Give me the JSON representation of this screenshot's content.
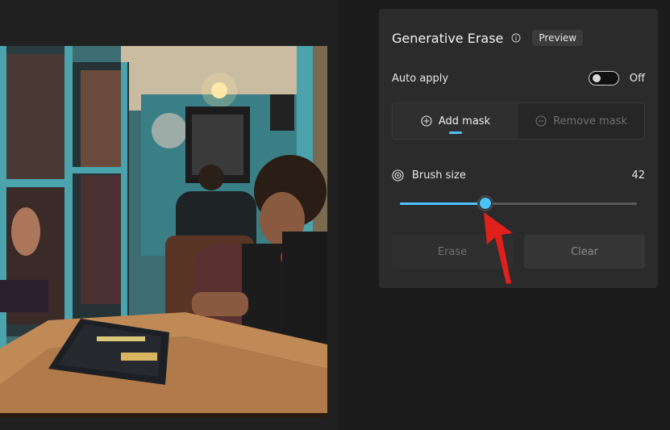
{
  "panel": {
    "title": "Generative Erase",
    "preview_badge": "Preview",
    "auto_apply": {
      "label": "Auto apply",
      "state": "Off"
    },
    "mask_tabs": {
      "add": "Add mask",
      "remove": "Remove mask",
      "active": "add"
    },
    "brush": {
      "label": "Brush size",
      "value": "42",
      "level_fraction": 0.36
    },
    "buttons": {
      "erase": "Erase",
      "clear": "Clear"
    }
  },
  "colors": {
    "accent": "#4cc2ff",
    "annotation_arrow": "#e0201a",
    "panel_bg": "#2b2b2b"
  },
  "icons": {
    "info": "info-icon",
    "add_mask": "plus-circle-icon",
    "remove_mask": "minus-circle-icon",
    "brush": "target-icon",
    "annotation": "red-arrow-icon"
  }
}
